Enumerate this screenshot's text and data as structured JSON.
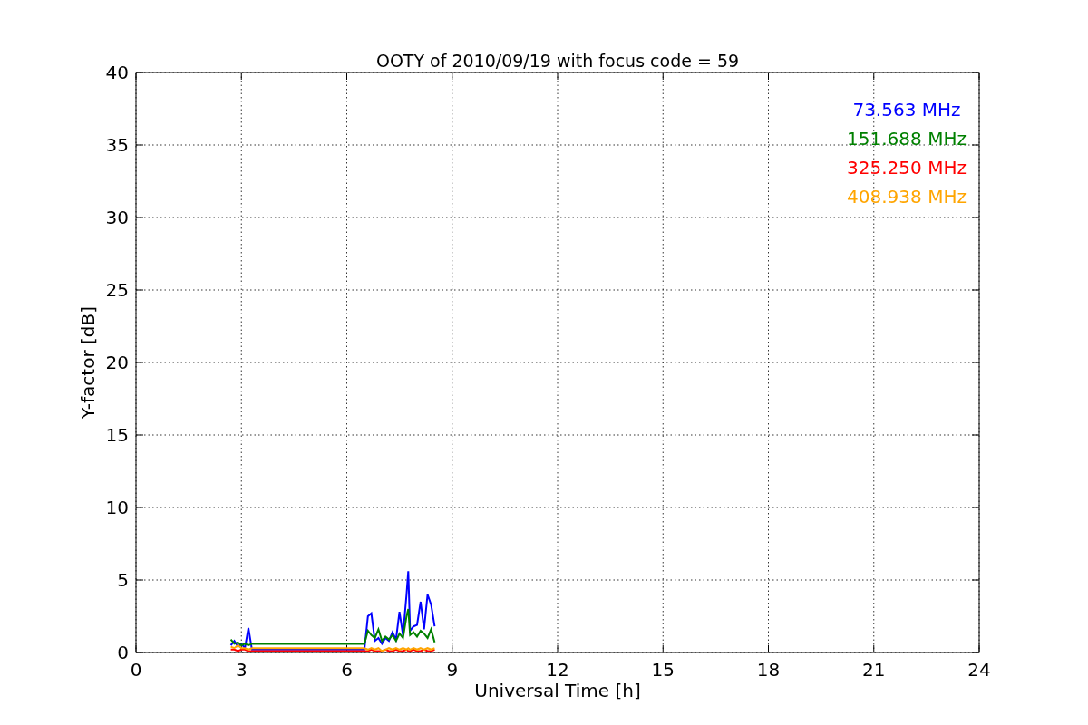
{
  "figure": {
    "chart_data": {
      "type": "line",
      "title": "OOTY of 2010/09/19 with focus code = 59",
      "xlabel": "Universal Time [h]",
      "ylabel": "Y-factor [dB]",
      "x": [
        2.7,
        2.8,
        2.9,
        3.0,
        3.1,
        3.2,
        3.3,
        6.5,
        6.6,
        6.7,
        6.8,
        6.9,
        7.0,
        7.1,
        7.2,
        7.3,
        7.4,
        7.5,
        7.6,
        7.7,
        7.75,
        7.8,
        7.9,
        8.0,
        8.1,
        8.2,
        8.3,
        8.4,
        8.5
      ],
      "series": [
        {
          "name": "73.563 MHz",
          "color": "#0000ff",
          "values": [
            0.5,
            0.8,
            0.4,
            0.6,
            0.3,
            1.7,
            0.2,
            0.2,
            2.5,
            2.7,
            0.8,
            1.0,
            0.6,
            1.0,
            0.8,
            1.4,
            0.9,
            2.8,
            1.2,
            4.0,
            5.6,
            1.5,
            1.8,
            1.9,
            3.5,
            1.6,
            4.0,
            3.3,
            1.8
          ]
        },
        {
          "name": "151.688 MHz",
          "color": "#008000",
          "values": [
            0.9,
            0.6,
            0.7,
            0.5,
            0.6,
            0.5,
            0.6,
            0.6,
            1.5,
            1.2,
            1.0,
            1.6,
            0.8,
            1.1,
            0.9,
            1.2,
            0.8,
            1.3,
            1.0,
            2.5,
            3.0,
            1.2,
            1.4,
            1.1,
            1.5,
            1.3,
            1.0,
            1.6,
            0.7
          ]
        },
        {
          "name": "325.250 MHz",
          "color": "#ff0000",
          "values": [
            0.2,
            0.2,
            0.1,
            0.2,
            0.2,
            0.1,
            0.1,
            0.1,
            0.1,
            0.2,
            0.1,
            0.1,
            0.1,
            0.2,
            0.1,
            0.1,
            0.2,
            0.1,
            0.1,
            0.2,
            0.1,
            0.1,
            0.2,
            0.1,
            0.1,
            0.2,
            0.1,
            0.1,
            0.2
          ]
        },
        {
          "name": "408.938 MHz",
          "color": "#ffa500",
          "values": [
            0.4,
            0.3,
            0.5,
            0.3,
            0.3,
            0.2,
            0.3,
            0.3,
            0.2,
            0.3,
            0.2,
            0.3,
            0.1,
            0.2,
            0.3,
            0.2,
            0.3,
            0.2,
            0.3,
            0.2,
            0.3,
            0.2,
            0.3,
            0.2,
            0.3,
            0.2,
            0.3,
            0.2,
            0.3
          ]
        }
      ],
      "xlim": [
        0,
        24
      ],
      "ylim": [
        0,
        40
      ],
      "xticks": [
        0,
        3,
        6,
        9,
        12,
        15,
        18,
        21,
        24
      ],
      "yticks": [
        0,
        5,
        10,
        15,
        20,
        25,
        30,
        35,
        40
      ],
      "grid": true
    }
  }
}
